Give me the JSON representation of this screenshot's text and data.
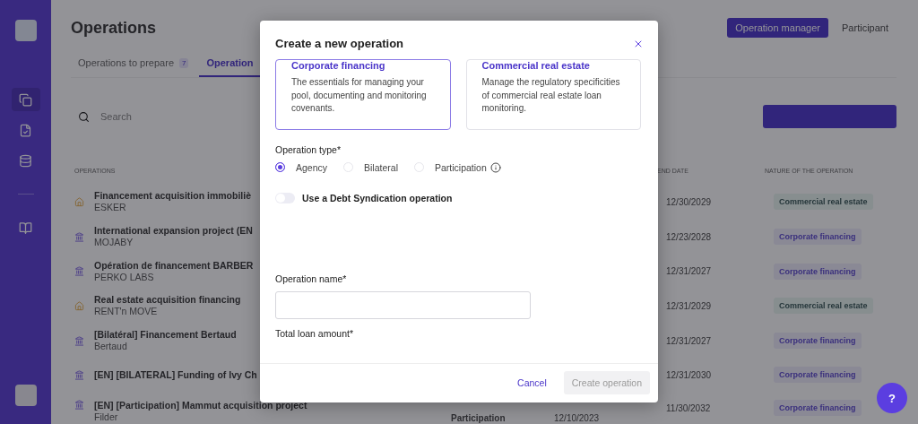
{
  "page": {
    "title": "Operations"
  },
  "roles": [
    {
      "label": "Operation manager",
      "selected": true
    },
    {
      "label": "Participant",
      "selected": false
    }
  ],
  "tabs": [
    {
      "label": "Operations to prepare",
      "badge": "7",
      "selected": false
    },
    {
      "label": "Operation",
      "selected": true
    }
  ],
  "search": {
    "placeholder": "Search"
  },
  "table": {
    "columns": [
      "OPERATIONS",
      "END DATE",
      "NATURE OF THE OPERATION"
    ],
    "rows": [
      {
        "kind": "real-estate",
        "name": "Financement acquisition immobiliè",
        "company": "ESKER",
        "end_date": "12/30/2029",
        "nature": {
          "label": "Commercial real estate",
          "kind": "real-estate"
        }
      },
      {
        "kind": "corporate",
        "name": "International expansion project (EN",
        "company": "MOJABY",
        "end_date": "12/23/2028",
        "nature": {
          "label": "Corporate financing",
          "kind": "corporate"
        }
      },
      {
        "kind": "corporate",
        "name": "Opération de financement BARBER",
        "company": "PERKO LABS",
        "end_date": "12/31/2027",
        "nature": {
          "label": "Corporate financing",
          "kind": "corporate"
        }
      },
      {
        "kind": "real-estate",
        "name": "Real estate acquisition financing",
        "company": "RENT'n MOVE",
        "end_date": "12/31/2029",
        "nature": {
          "label": "Commercial real estate",
          "kind": "real-estate"
        }
      },
      {
        "kind": "corporate",
        "name": "[Bilatéral] Financement Bertaud",
        "company": "Bertaud",
        "end_date": "12/31/2027",
        "nature": {
          "label": "Corporate financing",
          "kind": "corporate"
        }
      },
      {
        "kind": "corporate",
        "name": "[EN] [BILATERAL] Funding of Ivy Ch",
        "end_date": "12/31/2030",
        "nature": {
          "label": "Corporate financing",
          "kind": "corporate"
        }
      },
      {
        "kind": "corporate",
        "name": "[EN] [Participation] Mammut acquisition project",
        "company": "Filder",
        "column_3": "Participation",
        "column_4": "12/10/2023",
        "end_date": "11/30/2032",
        "nature": {
          "label": "Corporate financing",
          "kind": "corporate"
        }
      }
    ]
  },
  "modal": {
    "title": "Create a new operation",
    "cards": [
      {
        "title": "Corporate financing",
        "text": "The essentials for managing your pool, documenting and monitoring covenants.",
        "selected": true
      },
      {
        "title": "Commercial real estate",
        "text": "Manage the regulatory specificities of commercial real estate loan monitoring.",
        "selected": false
      }
    ],
    "operation_type": {
      "label": "Operation type*",
      "options": [
        {
          "label": "Agency",
          "selected": true
        },
        {
          "label": "Bilateral",
          "selected": false
        },
        {
          "label": "Participation",
          "selected": false,
          "info": true
        }
      ]
    },
    "syndication_toggle": {
      "label": "Use a Debt Syndication operation",
      "on": false
    },
    "name_field": {
      "label": "Operation name*"
    },
    "amount_field": {
      "label": "Total loan amount*"
    },
    "buttons": [
      {
        "label": "Cancel",
        "kind": "link",
        "disabled": false
      },
      {
        "label": "Create operation",
        "kind": "primary",
        "disabled": true
      }
    ]
  },
  "help": {
    "label": "?"
  }
}
